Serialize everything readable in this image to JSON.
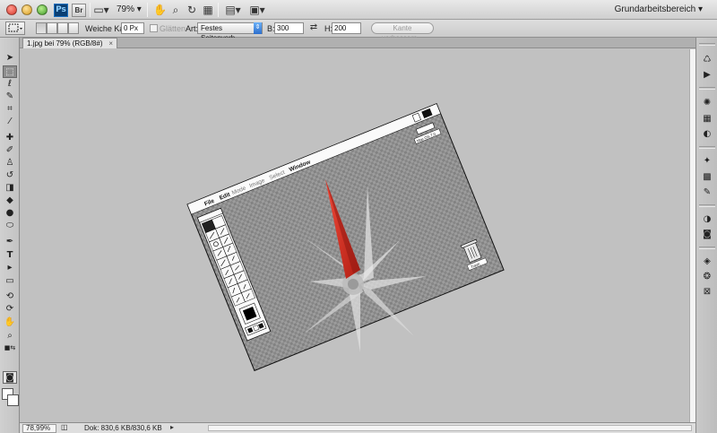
{
  "appbar": {
    "ps_label": "Ps",
    "br_label": "Br",
    "zoom": "79%",
    "workspace": "Grundarbeitsbereich ▾"
  },
  "options": {
    "feather_label": "Weiche Kante:",
    "feather_value": "0 Px",
    "antialias_label": "Glätten",
    "style_label": "Art:",
    "style_value": "Festes Seitenverh...",
    "width_label": "B:",
    "width_value": "300",
    "height_label": "H:",
    "height_value": "200",
    "refine_label": "Kante verbessern..."
  },
  "document": {
    "tab_title": "1.jpg bei 79% (RGB/8#)",
    "tab_close": "×",
    "status_zoom": "78,99%",
    "status_info": "Dok: 830,6 KB/830,6 KB"
  },
  "artwork": {
    "menu": [
      "File",
      "Edit",
      "Mode",
      "Image",
      "Select",
      "Window"
    ],
    "disk_label": "Mac OS 7.0",
    "trash_label": "Trash",
    "accent_red": "#e23b2c"
  }
}
